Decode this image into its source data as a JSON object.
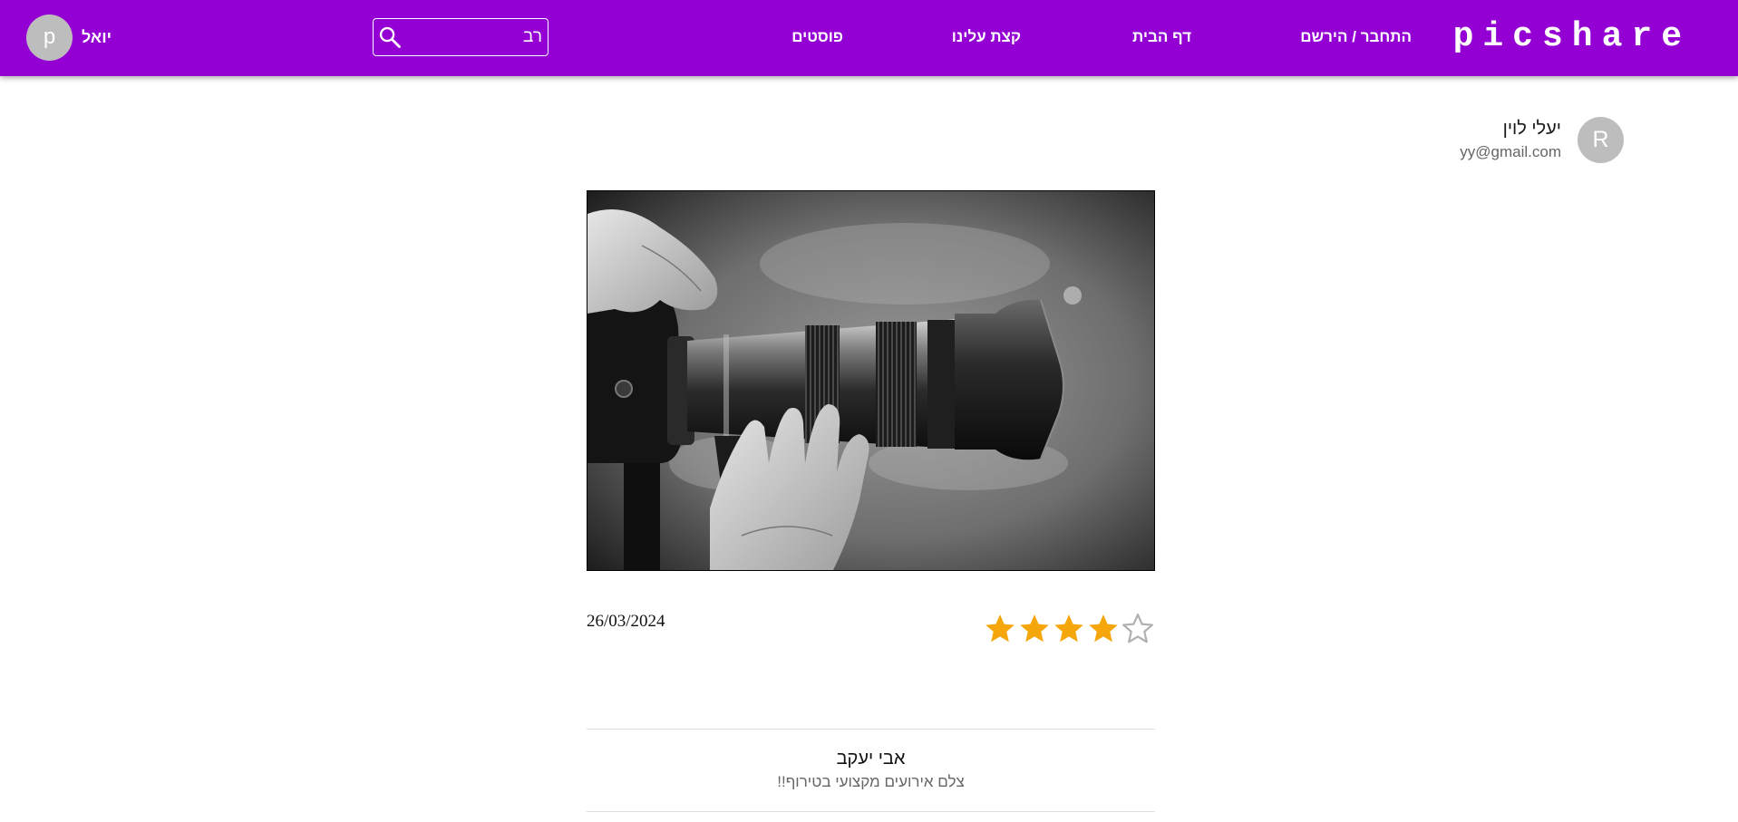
{
  "header": {
    "brand": "picshare",
    "nav": {
      "login_register": "התחבר / הירשם",
      "home": "דף הבית",
      "about": "קצת עלינו",
      "posts": "פוסטים"
    },
    "search": {
      "value": "רב",
      "icon": "search-icon"
    },
    "user": {
      "avatar_letter": "p",
      "name": "יואל"
    }
  },
  "post": {
    "author": {
      "avatar_letter": "R",
      "name": "יעלי לוין",
      "email": "yy@gmail.com"
    },
    "image": {
      "subject": "photographer-hands-telephoto-lens",
      "style": "black-and-white"
    },
    "rating": {
      "value": 4,
      "max": 5
    },
    "date": "26/03/2024"
  },
  "comments": [
    {
      "author": "אבי יעקב",
      "text": "צלם אירועים מקצועי בטירוף!!"
    }
  ],
  "colors": {
    "header_bg": "#9400d3",
    "star_filled": "#f5a60a",
    "star_empty": "#b0b0b0",
    "avatar_bg": "#bdbdbd"
  }
}
